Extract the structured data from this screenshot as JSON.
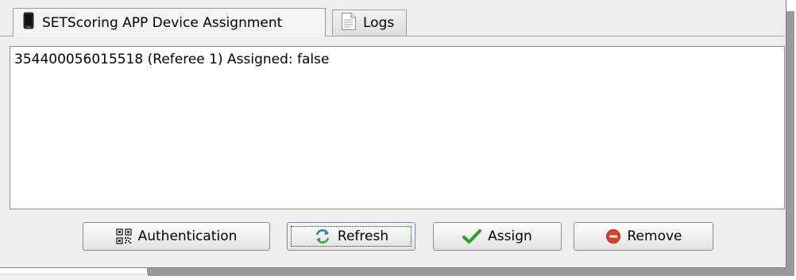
{
  "tabs": [
    {
      "label": "SETScoring APP Device Assignment",
      "icon": "phone-icon",
      "active": true
    },
    {
      "label": "Logs",
      "icon": "document-icon",
      "active": false
    }
  ],
  "device_list": {
    "items": [
      "354400056015518 (Referee 1) Assigned: false"
    ]
  },
  "buttons": {
    "authentication": {
      "label": "Authentication",
      "icon": "qr-code-icon"
    },
    "refresh": {
      "label": "Refresh",
      "icon": "refresh-icon",
      "focused": true
    },
    "assign": {
      "label": "Assign",
      "icon": "checkmark-icon",
      "color": "#2e9e2e"
    },
    "remove": {
      "label": "Remove",
      "icon": "minus-circle-icon",
      "color": "#d9432f"
    }
  }
}
